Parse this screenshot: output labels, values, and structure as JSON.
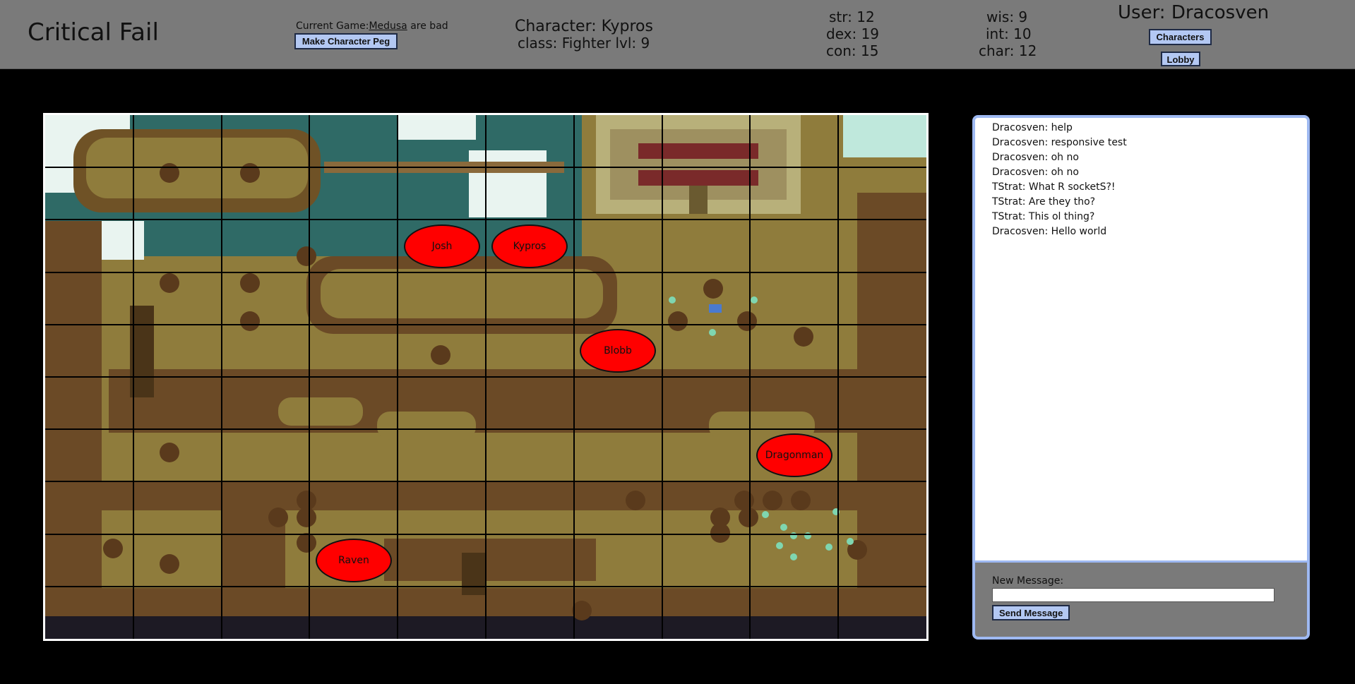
{
  "header": {
    "app_title": "Critical Fail",
    "current_game_label": "Current Game:",
    "current_game_name": "Medusa",
    "current_game_suffix": "are bad",
    "make_peg_label": "Make Character Peg",
    "character": "Character: Kypros",
    "class": "class: Fighter lvl: 9",
    "stats": {
      "str": "str: 12",
      "dex": "dex: 19",
      "con": "con: 15",
      "wis": "wis: 9",
      "int": "int: 10",
      "char": "char: 12"
    },
    "user": "User: Dracosven",
    "characters_label": "Characters",
    "lobby_label": "Lobby"
  },
  "map": {
    "grid_columns": 10,
    "grid_rows": 10,
    "pegs": [
      {
        "name": "Josh",
        "col": 4,
        "row": 2,
        "color": "#ff0000"
      },
      {
        "name": "Kypros",
        "col": 5,
        "row": 2,
        "color": "#ff0000"
      },
      {
        "name": "Blobb",
        "col": 6,
        "row": 4,
        "color": "#ff0000"
      },
      {
        "name": "Dragonman",
        "col": 8,
        "row": 6,
        "color": "#ff0000"
      },
      {
        "name": "Raven",
        "col": 3,
        "row": 8,
        "color": "#ff0000"
      }
    ]
  },
  "chat": {
    "messages": [
      "Dracosven: help",
      "Dracosven: responsive test",
      "Dracosven: oh no",
      "Dracosven: oh no",
      "TStrat: What R socketS?!",
      "TStrat: Are they tho?",
      "TStrat: This ol thing?",
      "Dracosven: Hello world"
    ],
    "new_message_label": "New Message:",
    "new_message_value": "",
    "send_label": "Send Message"
  },
  "colors": {
    "header_bg": "#7a7a7a",
    "button_bg": "#b3c8f3",
    "peg": "#ff0000",
    "chat_border": "#9eb9f2"
  }
}
